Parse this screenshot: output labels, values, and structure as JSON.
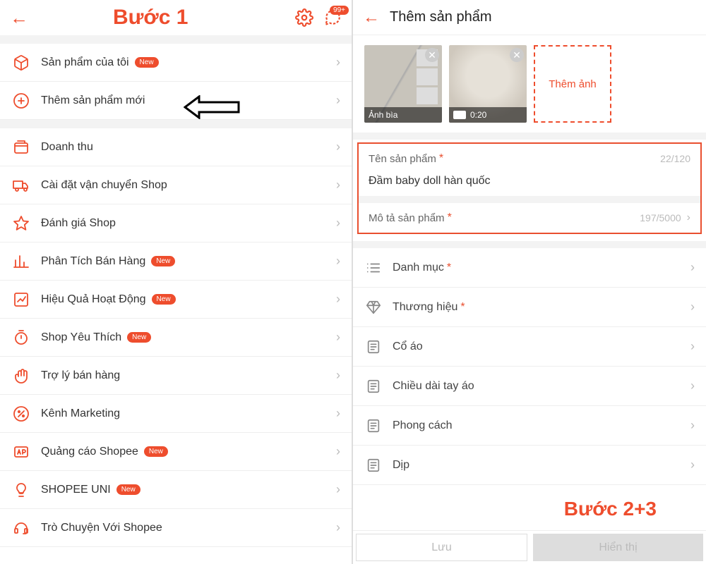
{
  "annotations": {
    "step1": "Bước 1",
    "step23": "Bước 2+3"
  },
  "left": {
    "header": {
      "chat_badge": "99+"
    },
    "group1": [
      {
        "id": "my-products",
        "label": "Sản phẩm của tôi",
        "icon": "cube",
        "new": true
      },
      {
        "id": "add-product",
        "label": "Thêm sản phẩm mới",
        "icon": "plus-circle",
        "new": false
      }
    ],
    "group2": [
      {
        "id": "revenue",
        "label": "Doanh thu",
        "icon": "wallet",
        "new": false
      },
      {
        "id": "shipping",
        "label": "Cài đặt vận chuyển Shop",
        "icon": "truck",
        "new": false
      },
      {
        "id": "rating",
        "label": "Đánh giá Shop",
        "icon": "star",
        "new": false
      },
      {
        "id": "analytics",
        "label": "Phân Tích Bán Hàng",
        "icon": "bars",
        "new": true
      },
      {
        "id": "performance",
        "label": "Hiệu Quả Hoạt Động",
        "icon": "trend",
        "new": true
      },
      {
        "id": "favorite",
        "label": "Shop Yêu Thích",
        "icon": "stopwatch",
        "new": true
      },
      {
        "id": "assistant",
        "label": "Trợ lý bán hàng",
        "icon": "hand",
        "new": false
      },
      {
        "id": "marketing",
        "label": "Kênh Marketing",
        "icon": "percent",
        "new": false
      },
      {
        "id": "ads",
        "label": "Quảng cáo Shopee",
        "icon": "ad",
        "new": true
      },
      {
        "id": "uni",
        "label": "SHOPEE UNI",
        "icon": "bulb",
        "new": true
      },
      {
        "id": "chat-shopee",
        "label": "Trò Chuyện Với Shopee",
        "icon": "headset",
        "new": false
      }
    ],
    "new_badge": "New"
  },
  "right": {
    "title": "Thêm sản phẩm",
    "images": {
      "cover_label": "Ảnh bìa",
      "video_time": "0:20",
      "add_label": "Thêm ảnh"
    },
    "name_field": {
      "label": "Tên sản phẩm",
      "count": "22/120",
      "value": "Đầm baby doll hàn quốc"
    },
    "desc_field": {
      "label": "Mô tả sản phẩm",
      "count": "197/5000"
    },
    "attrs": [
      {
        "id": "category",
        "label": "Danh mục",
        "required": true,
        "icon": "list"
      },
      {
        "id": "brand",
        "label": "Thương hiệu",
        "required": true,
        "icon": "diamond"
      },
      {
        "id": "collar",
        "label": "Cổ áo",
        "required": false,
        "icon": "note"
      },
      {
        "id": "sleeve",
        "label": "Chiều dài tay áo",
        "required": false,
        "icon": "note"
      },
      {
        "id": "style",
        "label": "Phong cách",
        "required": false,
        "icon": "note"
      },
      {
        "id": "occasion",
        "label": "Dịp",
        "required": false,
        "icon": "note"
      }
    ],
    "buttons": {
      "save": "Lưu",
      "show": "Hiển thị"
    }
  }
}
